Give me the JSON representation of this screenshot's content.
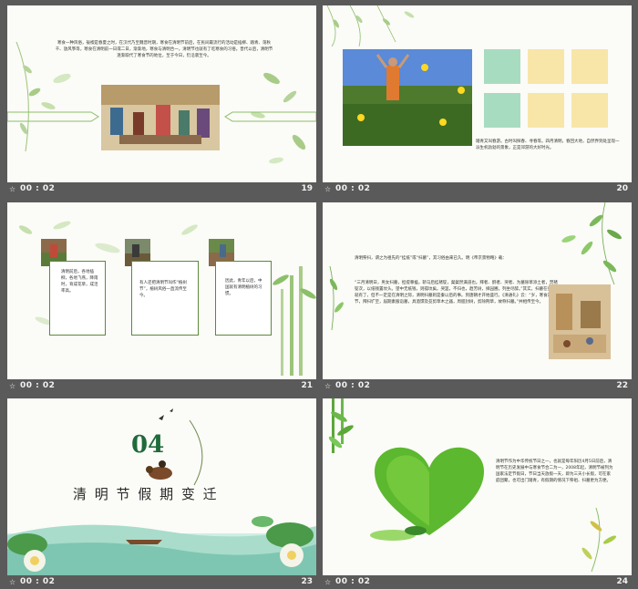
{
  "slides": [
    {
      "number": "19",
      "time": "00 : 02",
      "paragraph": "寒食一种风俗，祓禊是春夏之时，在汉代乃至魏晋时期，寒食在清明节前后，在民间最流行的活动是插柳、踏青、荡秋千、放风筝等，寒食在清明前一日或二日，渐渐地，寒食与清明合一，清明节也就有了吃寒食的习俗。晋代以后，清明节逐渐取代了寒食节的地位，至于今日，仍沿袭至今。"
    },
    {
      "number": "20",
      "time": "00 : 02",
      "caption": "踏青又叫春游。古时叫探春、寻春等。四月清明，春回大地，自然界到处呈现一派生机勃勃的景象，正是郊游的大好时光。",
      "grid_colors": [
        "#a8dcc0",
        "#f8e6a8",
        "#f8e6a8",
        "#a8dcc0",
        "#f8e6a8",
        "#f8e6a8"
      ]
    },
    {
      "number": "21",
      "time": "00 : 02",
      "cards": [
        {
          "text": "清明前后，各地插柳，各地飞燕，降雨时，育成花草，成活率高。"
        },
        {
          "text": "有人还把清明节叫作“植树节”，植树风俗一直流传至今。"
        },
        {
          "text": "因此，青年以后，中国就有清明植树的习惯。"
        }
      ]
    },
    {
      "number": "22",
      "time": "00 : 02",
      "para1": "清明祭扫，谓之为祖先的“挂纸”或“扫墓”，其习俗由来已久。明《帝京景物略》载：",
      "para2": "“三月清明日，男女扫墓，担提尊榼，轿马后挂楮锭，粲粲然满道也。拜者、酹者、哭者、为墓除草添土者，焚楮锭次，以纸钱置坟头。望中无纸钱，则孤坟矣。哭罢，不归也，趋芳树，择园圃，列坐尽醉。”其实，扫墓在秦以前就有了，但不一定是在清明之际，清明扫墓则是秦以后的事。到唐朝才开始盛行。《清通礼》云：“岁，寒食及霜降节，拜扫圹茔，届期素服诣墓，具酒馔及芟剪草木之器，周胝封树，剪除荆草，故称扫墓。”并相传至今。"
    },
    {
      "number": "23",
      "time": "00 : 02",
      "badge": "04",
      "title": "清 明 节 假 期 变 迁"
    },
    {
      "number": "24",
      "time": "00 : 02",
      "paragraph": "清明节作为中华传统节日之一，也就是每年阳历4月5日前后，清明节在历史发展中与寒食节合二为一，2008年起，清明节被列为国家法定节假日，节日当天放假一天，即为三天小长假，可在家庭团聚，也可出门踏青，有假期的情况下祭祖、扫墓更为方便。"
    }
  ]
}
